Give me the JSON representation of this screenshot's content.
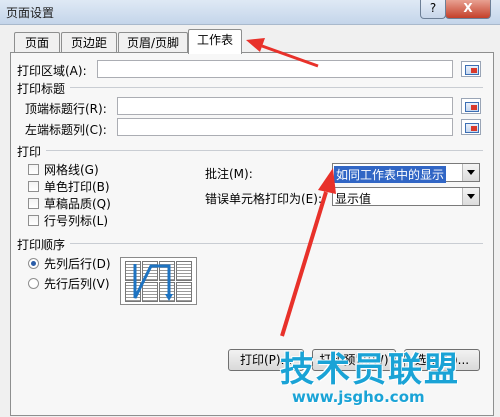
{
  "window": {
    "title": "页面设置",
    "help": "?",
    "close": "X"
  },
  "tabs": [
    "页面",
    "页边距",
    "页眉/页脚",
    "工作表"
  ],
  "print_area": {
    "label": "打印区域(A):",
    "value": ""
  },
  "print_titles": {
    "heading": "打印标题",
    "rows_label": "顶端标题行(R):",
    "cols_label": "左端标题列(C):"
  },
  "print": {
    "heading": "打印",
    "gridlines": "网格线(G)",
    "bw": "单色打印(B)",
    "draft": "草稿品质(Q)",
    "headings": "行号列标(L)",
    "comments_label": "批注(M):",
    "comments_value": "如同工作表中的显示",
    "errors_label": "错误单元格打印为(E):",
    "errors_value": "显示值"
  },
  "order": {
    "heading": "打印顺序",
    "down_then_over": "先列后行(D)",
    "over_then_down": "先行后列(V)",
    "selected": "down_then_over"
  },
  "buttons": {
    "print": "打印(P)...",
    "preview": "打印预览(W)",
    "options": "选项(O)..."
  },
  "watermark": {
    "cn": "技术员联盟",
    "url": "www.jsgho.com"
  },
  "colors": {
    "highlight": "#3166c5",
    "arrow": "#e8312a",
    "watermark": "#1aa3d6"
  }
}
